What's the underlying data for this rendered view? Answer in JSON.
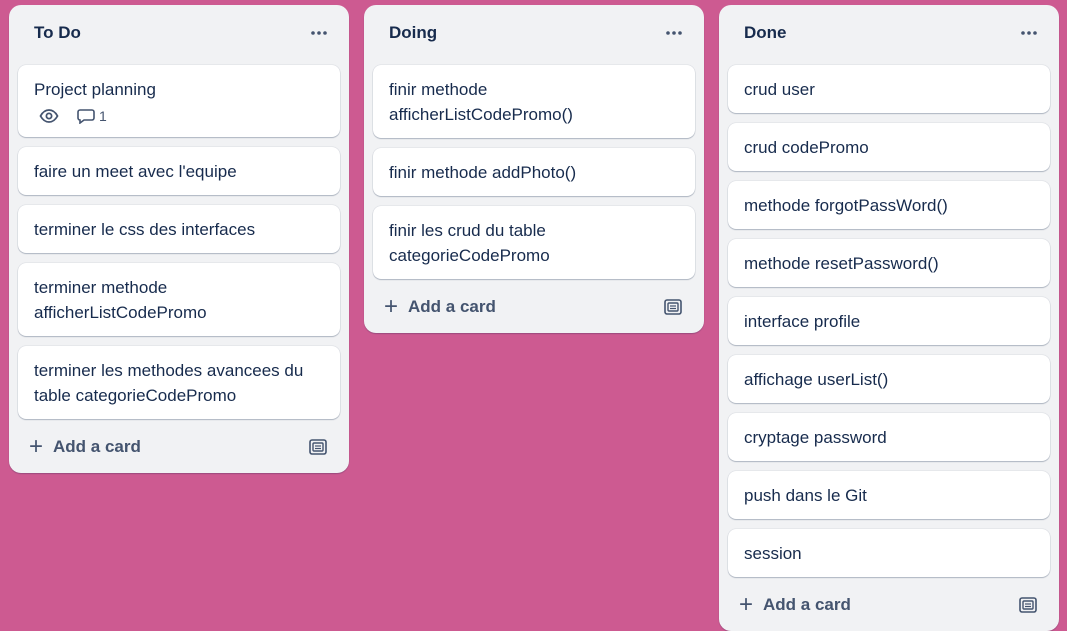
{
  "lists": [
    {
      "title": "To Do",
      "add_card_label": "Add a card",
      "cards": [
        {
          "title": "Project planning",
          "badges": {
            "watch": true,
            "comments": "1"
          }
        },
        {
          "title": "faire un meet avec l'equipe"
        },
        {
          "title": "terminer le css des interfaces"
        },
        {
          "title": "terminer methode afficherListCodePromo"
        },
        {
          "title": "terminer les methodes avancees du table categorieCodePromo"
        }
      ]
    },
    {
      "title": "Doing",
      "add_card_label": "Add a card",
      "cards": [
        {
          "title": "finir methode afficherListCodePromo()"
        },
        {
          "title": "finir methode addPhoto()"
        },
        {
          "title": "finir les crud du table categorieCodePromo"
        }
      ]
    },
    {
      "title": "Done",
      "add_card_label": "Add a card",
      "cards": [
        {
          "title": "crud user"
        },
        {
          "title": "crud codePromo"
        },
        {
          "title": "methode forgotPassWord()"
        },
        {
          "title": "methode resetPassword()"
        },
        {
          "title": "interface profile"
        },
        {
          "title": "affichage userList()"
        },
        {
          "title": "cryptage password"
        },
        {
          "title": "push dans le Git"
        },
        {
          "title": "session"
        }
      ]
    }
  ],
  "icons": {
    "list_menu": "ellipsis-icon",
    "watch": "eye-icon",
    "comments": "speech-bubble-icon",
    "add": "plus-icon",
    "template": "card-template-icon"
  },
  "colors": {
    "board_background": "#cd5a91",
    "list_background": "#f1f2f4",
    "card_background": "#ffffff",
    "text": "#172b4d",
    "subtle_text": "#44546f"
  }
}
